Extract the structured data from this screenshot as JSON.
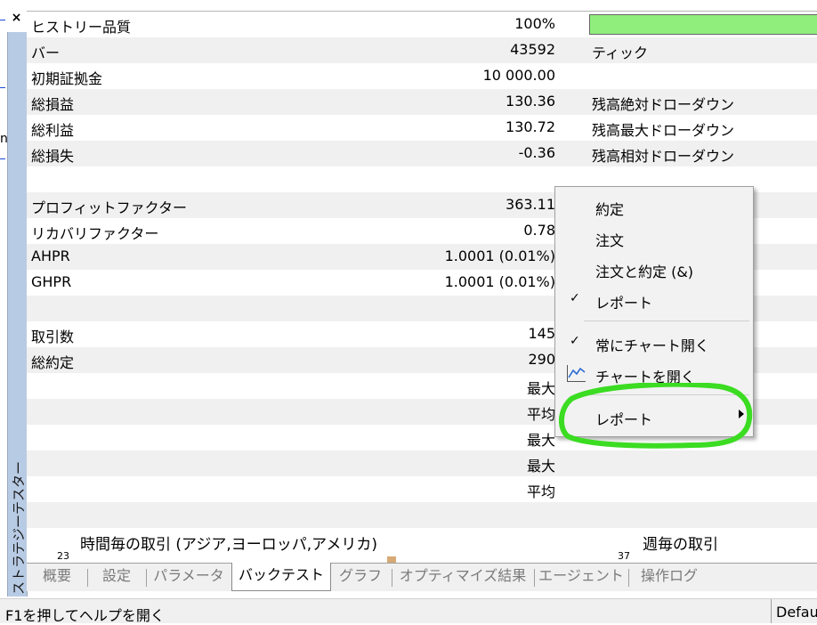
{
  "window": {
    "vertical_label": "ストラテジーテスター",
    "close_glyph": "×",
    "left_edge_glyph": "n"
  },
  "report": {
    "rows": [
      {
        "label": "ヒストリー品質",
        "value": "100%",
        "label2": "",
        "alt": false,
        "quality_bar": true
      },
      {
        "label": "バー",
        "value": "43592",
        "label2": "ティック",
        "alt": true
      },
      {
        "label": "初期証拠金",
        "value": "10 000.00",
        "label2": "",
        "alt": false
      },
      {
        "label": "総損益",
        "value": "130.36",
        "label2": "残高絶対ドローダウン",
        "alt": true
      },
      {
        "label": "総利益",
        "value": "130.72",
        "label2": "残高最大ドローダウン",
        "alt": false
      },
      {
        "label": "総損失",
        "value": "-0.36",
        "label2": "残高相対ドローダウン",
        "alt": true
      },
      {
        "label": "",
        "value": "",
        "label2": "",
        "alt": false
      },
      {
        "label": "プロフィットファクター",
        "value": "363.11",
        "label2": "",
        "alt": true
      },
      {
        "label": "リカバリファクター",
        "value": "0.78",
        "label2": "",
        "alt": false
      },
      {
        "label": "AHPR",
        "value": "1.0001 (0.01%)",
        "label2": "",
        "alt": true
      },
      {
        "label": "GHPR",
        "value": "1.0001 (0.01%)",
        "label2": "",
        "alt": false
      },
      {
        "label": "",
        "value": "",
        "label2": "",
        "alt": true
      },
      {
        "label": "取引数",
        "value": "145",
        "label2": "",
        "alt": false
      },
      {
        "label": "総約定",
        "value": "290",
        "label2": "",
        "alt": true
      },
      {
        "label": "",
        "value": "最大",
        "label2": "",
        "alt": false
      },
      {
        "label": "",
        "value": "平均",
        "label2": "",
        "alt": true
      },
      {
        "label": "",
        "value": "最大",
        "label2": "",
        "alt": false
      },
      {
        "label": "",
        "value": "最大",
        "label2": "",
        "alt": true
      },
      {
        "label": "",
        "value": "平均",
        "label2": "",
        "alt": false
      },
      {
        "label": "",
        "value": "",
        "label2": "",
        "alt": true
      }
    ],
    "hourly_chart": {
      "title": "時間毎の取引 (アジア,ヨーロッパ,アメリカ)",
      "axis_max": "23"
    },
    "weekly_chart": {
      "title": "週毎の取引",
      "axis_max": "37"
    }
  },
  "context_menu": {
    "items": [
      {
        "label": "約定",
        "checked": false,
        "icon": "",
        "submenu": false
      },
      {
        "label": "注文",
        "checked": false,
        "icon": "",
        "submenu": false
      },
      {
        "label": "注文と約定 (&)",
        "checked": false,
        "icon": "",
        "submenu": false
      },
      {
        "label": "レポート",
        "checked": true,
        "icon": "",
        "submenu": false
      },
      {
        "separator": true
      },
      {
        "label": "常にチャート開く",
        "checked": true,
        "icon": "",
        "submenu": false
      },
      {
        "label": "チャートを開く",
        "checked": false,
        "icon": "chart-line-icon",
        "submenu": false
      },
      {
        "separator": true
      },
      {
        "label": "レポート",
        "checked": false,
        "icon": "",
        "submenu": true
      }
    ],
    "check_glyph": "✓",
    "highlight_color": "#3bdc22"
  },
  "tabs": [
    {
      "label": "概要",
      "active": false
    },
    {
      "label": "設定",
      "active": false
    },
    {
      "label": "パラメータ",
      "active": false
    },
    {
      "label": "バックテスト",
      "active": true
    },
    {
      "label": "グラフ",
      "active": false
    },
    {
      "label": "オプティマイズ結果",
      "active": false
    },
    {
      "label": "エージェント",
      "active": false
    },
    {
      "label": "操作ログ",
      "active": false
    }
  ],
  "statusbar": {
    "help_text": "F1を押してヘルプを開く",
    "profile": "Defau"
  },
  "colors": {
    "quality_bar": "#90ee7d",
    "side_bar": "#b8cbe4",
    "chart_bar": "#d7aa75"
  }
}
